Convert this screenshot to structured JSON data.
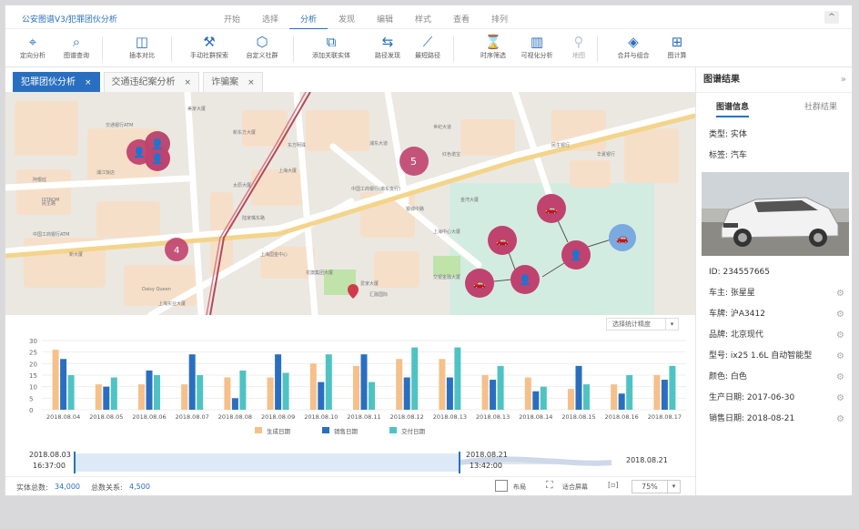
{
  "titlebar": {
    "app_title": "公安图谱V3/犯罪团伙分析",
    "menu": [
      "开始",
      "选择",
      "分析",
      "发现",
      "编辑",
      "样式",
      "查看",
      "排列"
    ],
    "active_menu": "分析",
    "collapse": "^"
  },
  "toolbar": [
    {
      "label": "定向分析",
      "icon": "target-icon"
    },
    {
      "label": "图谱查询",
      "icon": "search-icon"
    },
    {
      "label": "插本对比",
      "icon": "compare-icon"
    },
    {
      "label": "手动社群探索",
      "icon": "wrench-icon"
    },
    {
      "label": "自定义社群",
      "icon": "cube-icon"
    },
    {
      "label": "添加关联实体",
      "icon": "link-entity-icon"
    },
    {
      "label": "路径发现",
      "icon": "path-discovery-icon"
    },
    {
      "label": "最短路径",
      "icon": "shortest-path-icon"
    },
    {
      "label": "时序筛选",
      "icon": "hourglass-icon"
    },
    {
      "label": "可视化分析",
      "icon": "bar-chart-icon"
    },
    {
      "label": "地图",
      "icon": "person-icon",
      "disabled": true
    },
    {
      "label": "合并与组合",
      "icon": "merge-icon"
    },
    {
      "label": "图计算",
      "icon": "graph-compute-icon"
    }
  ],
  "tabs": [
    {
      "label": "犯罪团伙分析",
      "active": true
    },
    {
      "label": "交通违纪案分析",
      "active": false
    },
    {
      "label": "诈骗案",
      "active": false
    }
  ],
  "map": {
    "clusters": [
      "5",
      "4"
    ],
    "place_labels": [
      "交通银行ATM",
      "中国工商银行ATM",
      "中国工商银行(甫东支行)",
      "爱家大厦",
      "汇融国际",
      "上海实业大厦",
      "Daisy Queen",
      "新东方大厦",
      "东方明珠",
      "红色诺宝",
      "金湾大厦",
      "浦东大道",
      "银城中路",
      "世纪大道",
      "上海大厦",
      "美家大厦",
      "民生路",
      "陆家嘴东路",
      "民生银行",
      "华夏银行",
      "上海国金中心",
      "花旗集团大厦",
      "上海中心大厦",
      "交银金融大厦",
      "ISTROM",
      "新大厦",
      "阿根廷",
      "太原大厦",
      "浦江饭店"
    ]
  },
  "chart_data": {
    "type": "bar",
    "categories": [
      "2018.08.04",
      "2018.08.05",
      "2018.08.06",
      "2018.08.07",
      "2018.08.08",
      "2018.08.09",
      "2018.08.10",
      "2018.08.11",
      "2018.08.12",
      "2018.08.13",
      "2018.08.13",
      "2018.08.14",
      "2018.08.15",
      "2018.08.16",
      "2018.08.17"
    ],
    "series": [
      {
        "name": "生成日期",
        "color": "#f5c08a",
        "values": [
          26,
          11,
          11,
          11,
          14,
          14,
          20,
          19,
          22,
          22,
          15,
          14,
          9,
          11,
          15
        ]
      },
      {
        "name": "销售日期",
        "color": "#2a6fbf",
        "values": [
          22,
          10,
          17,
          24,
          5,
          24,
          12,
          24,
          14,
          14,
          13,
          8,
          19,
          7,
          13
        ]
      },
      {
        "name": "交付日期",
        "color": "#4fc3c3",
        "values": [
          15,
          14,
          15,
          15,
          17,
          16,
          24,
          12,
          27,
          27,
          19,
          10,
          11,
          15,
          19
        ]
      }
    ],
    "ylim": [
      0,
      30
    ],
    "yticks": [
      0,
      5,
      10,
      15,
      20,
      25,
      30
    ],
    "select_label": "选择统计精度"
  },
  "timeline": {
    "start_date": "2018.08.03",
    "start_time": "16:37:00",
    "mid_date": "2018.08.21",
    "mid_time": "13:42:00",
    "end_date": "2018.08.21"
  },
  "status": {
    "entity_label": "实体总数:",
    "entity_count": "34,000",
    "relation_label": "总数关系:",
    "relation_count": "4,500",
    "layout": "布局",
    "fit": "适合屏幕",
    "zoom": "75%"
  },
  "panel": {
    "title": "图谱结果",
    "expand": "»",
    "tabs": [
      "图谱信息",
      "社群结果"
    ],
    "type": "类型: 实体",
    "tag": "标签: 汽车",
    "id": "ID: 234557665",
    "owner": "车主: 张星星",
    "plate": "车牌: 沪A3412",
    "brand": "品牌: 北京现代",
    "model": "型号: ix25 1.6L 自动智能型",
    "color": "颜色: 白色",
    "produced": "生产日期: 2017-06-30",
    "sold": "销售日期: 2018-08-21"
  }
}
